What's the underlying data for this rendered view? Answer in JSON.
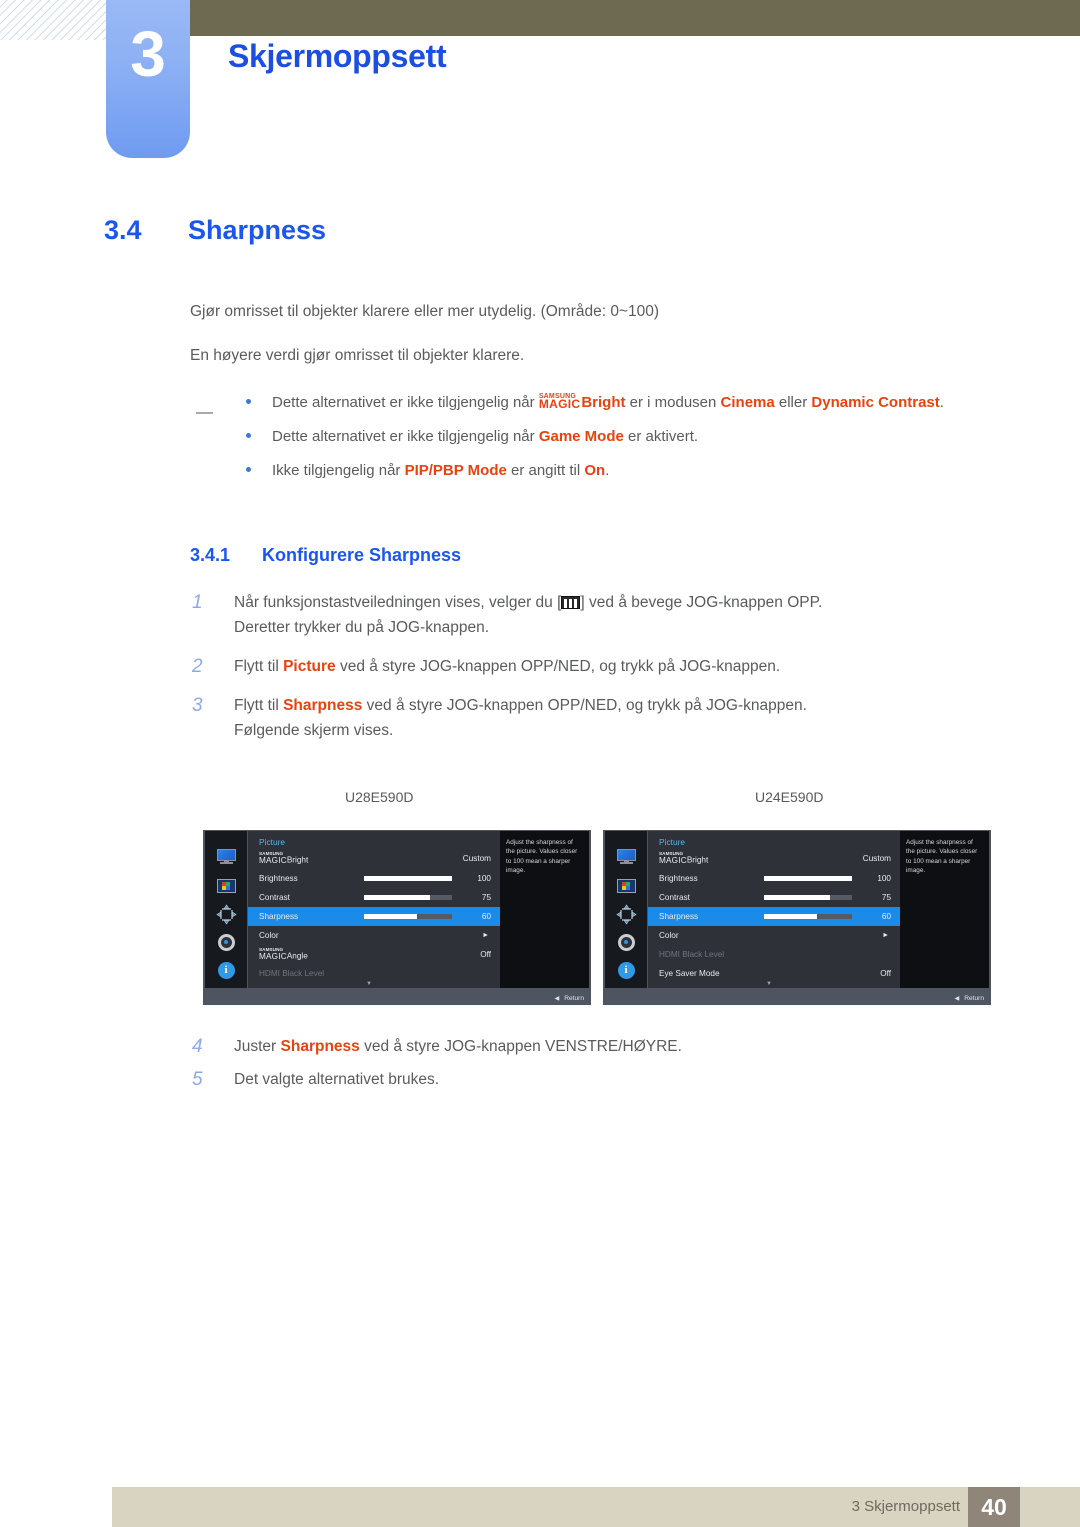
{
  "header": {
    "chapter_number": "3",
    "chapter_title": "Skjermoppsett",
    "bar_color": "#6e6a52",
    "tab_color": "#7ea6f3",
    "title_color": "#1a4fe0"
  },
  "section": {
    "number": "3.4",
    "title": "Sharpness",
    "heading_color": "#1a56ef"
  },
  "body": {
    "paragraph_1": "Gjør omrisset til objekter klarere eller mer utydelig. (Område: 0~100)",
    "paragraph_2": "En høyere verdi gjør omrisset til objekter klarere."
  },
  "notes": [
    {
      "prefix": "Dette alternativet er ikke tilgjengelig når ",
      "magic_top": "SAMSUNG",
      "magic_bottom": "MAGIC",
      "magic_suffix": "Bright",
      "mid": " er i modusen ",
      "hl1": "Cinema",
      "mid2": " eller ",
      "hl2": "Dynamic Contrast",
      "suffix": "."
    },
    {
      "prefix": "Dette alternativet er ikke tilgjengelig når ",
      "hl1": "Game Mode",
      "suffix": " er aktivert."
    },
    {
      "prefix": "Ikke tilgjengelig når ",
      "hl1": "PIP/PBP Mode",
      "mid": " er angitt til ",
      "hl2": "On",
      "suffix": "."
    }
  ],
  "subsection": {
    "number": "3.4.1",
    "title": "Konfigurere Sharpness"
  },
  "steps": [
    {
      "n": "1",
      "pre": "Når funksjonstastveiledningen vises, velger du [",
      "post": "] ved å bevege JOG-knappen OPP.",
      "cont": "Deretter trykker du på JOG-knappen."
    },
    {
      "n": "2",
      "pre": "Flytt til ",
      "hl": "Picture",
      "post": " ved å styre JOG-knappen OPP/NED, og trykk på JOG-knappen."
    },
    {
      "n": "3",
      "pre": "Flytt til ",
      "hl": "Sharpness",
      "post": " ved å styre JOG-knappen OPP/NED, og trykk på JOG-knappen.",
      "cont": "Følgende skjerm vises."
    },
    {
      "n": "4",
      "pre": "Juster ",
      "hl": "Sharpness",
      "post": " ved å styre JOG-knappen VENSTRE/HØYRE."
    },
    {
      "n": "5",
      "pre": "Det valgte alternativet brukes."
    }
  ],
  "osd_left": {
    "model": "U28E590D",
    "menu_title": "Picture",
    "description": "Adjust the sharpness of the picture. Values closer to 100 mean a sharper image.",
    "return_label": "Return",
    "rows": [
      {
        "magic_top": "SAMSUNG",
        "magic_bottom": "MAGIC",
        "label_suffix": "Bright",
        "value": "Custom",
        "type": "magic"
      },
      {
        "label": "Brightness",
        "value": "100",
        "type": "slider",
        "fill": 100
      },
      {
        "label": "Contrast",
        "value": "75",
        "type": "slider",
        "fill": 75
      },
      {
        "label": "Sharpness",
        "value": "60",
        "type": "slider",
        "fill": 60,
        "selected": true
      },
      {
        "label": "Color",
        "value": "",
        "type": "submenu"
      },
      {
        "magic_top": "SAMSUNG",
        "magic_bottom": "MAGIC",
        "label_suffix": "Angle",
        "value": "Off",
        "type": "magic"
      },
      {
        "label": "HDMI Black Level",
        "value": "",
        "type": "disabled"
      }
    ]
  },
  "osd_right": {
    "model": "U24E590D",
    "menu_title": "Picture",
    "description": "Adjust the sharpness of the picture. Values closer to 100 mean a sharper image.",
    "return_label": "Return",
    "rows": [
      {
        "magic_top": "SAMSUNG",
        "magic_bottom": "MAGIC",
        "label_suffix": "Bright",
        "value": "Custom",
        "type": "magic"
      },
      {
        "label": "Brightness",
        "value": "100",
        "type": "slider",
        "fill": 100
      },
      {
        "label": "Contrast",
        "value": "75",
        "type": "slider",
        "fill": 75
      },
      {
        "label": "Sharpness",
        "value": "60",
        "type": "slider",
        "fill": 60,
        "selected": true
      },
      {
        "label": "Color",
        "value": "",
        "type": "submenu"
      },
      {
        "label": "HDMI Black Level",
        "value": "",
        "type": "disabled"
      },
      {
        "label": "Eye Saver Mode",
        "value": "Off",
        "type": "plain"
      }
    ]
  },
  "footer": {
    "text": "3 Skjermoppsett",
    "page": "40",
    "bar_color": "#d9d4c2",
    "page_box_color": "#8f8578"
  }
}
